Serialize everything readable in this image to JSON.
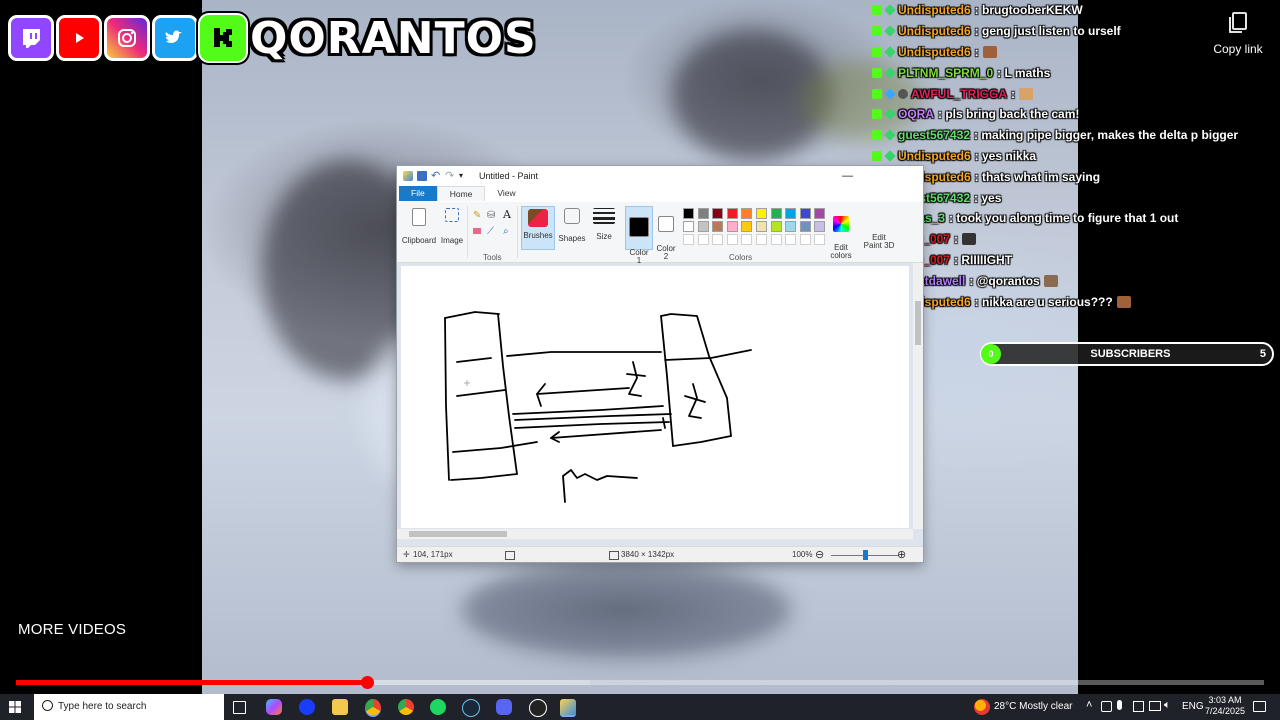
{
  "logo": {
    "text": "QORANTOS",
    "socials": [
      "twitch-icon",
      "youtube-icon",
      "instagram-icon",
      "twitter-icon",
      "kick-icon"
    ]
  },
  "chat": [
    {
      "user": "Undisputed6",
      "color": "#f6a623",
      "text": ": brugtooberKEKW",
      "badges": [
        "k",
        "g"
      ]
    },
    {
      "user": "Undisputed6",
      "color": "#f6a623",
      "text": ": geng just listen to urself",
      "badges": [
        "k",
        "g"
      ]
    },
    {
      "user": "Undisputed6",
      "color": "#f6a623",
      "text": ":",
      "badges": [
        "k",
        "g"
      ],
      "emote": "#a0603a"
    },
    {
      "user": "PLTNM_SPRM_0",
      "color": "#7ddc3c",
      "text": ": L maths",
      "badges": [
        "k",
        "g"
      ]
    },
    {
      "user": "AWFUL_TRIGGA",
      "color": "#e0205a",
      "text": ":",
      "badges": [
        "k",
        "c",
        "d"
      ],
      "emote": "#d9a26b"
    },
    {
      "user": "OQRA",
      "color": "#c77dff",
      "text": ": pls bring back the cam!",
      "badges": [
        "k",
        "g"
      ]
    },
    {
      "user": "guest567432",
      "color": "#5fe06b",
      "text": ": making pipe bigger, makes the delta p bigger",
      "badges": [
        "k",
        "g"
      ]
    },
    {
      "user": "Undisputed6",
      "color": "#f6a623",
      "text": ": yes nikka",
      "badges": [
        "k",
        "g"
      ]
    },
    {
      "user": "Undisputed6",
      "color": "#f6a623",
      "text": ": thats what im saying",
      "badges": [
        "k",
        "g"
      ]
    },
    {
      "user": "guest567432",
      "color": "#5fe06b",
      "text": ": yes",
      "badges": [
        "k",
        "g"
      ]
    },
    {
      "user": "nas_3",
      "color": "#5fe06b",
      "text": ": took you along time to figure that 1 out",
      "badges": [
        "k",
        "c",
        "d"
      ]
    },
    {
      "user": "RED_007",
      "color": "#e01c1c",
      "text": ":",
      "badges": [
        "k",
        "g"
      ],
      "emote": "#333333"
    },
    {
      "user": "RED_007",
      "color": "#e01c1c",
      "text": ": RIIIIIGHT",
      "badges": [
        "k",
        "g"
      ]
    },
    {
      "user": "WHatdawell",
      "color": "#b07cff",
      "text": ": @qorantos",
      "badges": [
        "k",
        "g"
      ],
      "emote": "#8a6a50"
    },
    {
      "user": "Undisputed6",
      "color": "#f6a623",
      "text": ": nikka are u serious???",
      "badges": [
        "k",
        "g"
      ],
      "emote": "#a0603a"
    }
  ],
  "copy_link": {
    "label": "Copy link",
    "icon": "copy-icon"
  },
  "subscribers": {
    "label": "SUBSCRIBERS",
    "current": "0",
    "goal": "5"
  },
  "more_videos": "MORE VIDEOS",
  "video_progress": {
    "played_fraction": 0.281,
    "loaded_fraction": 0.46
  },
  "paint": {
    "title": "Untitled - Paint",
    "tabs": [
      "File",
      "Home",
      "View"
    ],
    "ribbon": {
      "clipboard": "Clipboard",
      "image": "Image",
      "tools": "Tools",
      "brushes": "Brushes",
      "shapes": "Shapes",
      "size": "Size",
      "color1": "Color\n1",
      "color2": "Color\n2",
      "colors": "Colors",
      "edit_colors": "Edit\ncolors",
      "edit_paint3d": "Edit\nPaint 3D"
    },
    "palette": [
      "#000000",
      "#7f7f7f",
      "#880015",
      "#ed1c24",
      "#ff7f27",
      "#fff200",
      "#22b14c",
      "#00a2e8",
      "#3f48cc",
      "#a349a4",
      "#ffffff",
      "#c3c3c3",
      "#b97a57",
      "#ffaec9",
      "#ffc90e",
      "#efe4b0",
      "#b5e61d",
      "#99d9ea",
      "#7092be",
      "#c8bfe7"
    ],
    "status": {
      "cursor": "104, 171px",
      "canvas_size": "3840 × 1342px",
      "zoom": "100%",
      "zoom_fraction": 0.5
    }
  },
  "taskbar": {
    "search_placeholder": "Type here to search",
    "weather": "28°C  Mostly clear",
    "language": "ENG",
    "time": "3:03 AM",
    "date": "7/24/2025"
  }
}
